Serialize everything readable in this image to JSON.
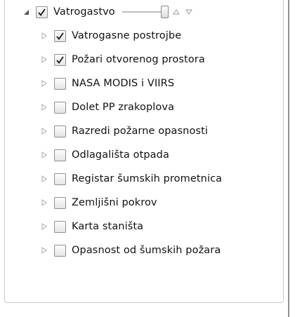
{
  "layer_tree": {
    "group": {
      "label": "Vatrogastvo",
      "checked": true,
      "expanded": true,
      "opacity_percent": 100
    },
    "children": [
      {
        "label": "Vatrogasne postrojbe",
        "checked": true
      },
      {
        "label": "Požari otvorenog prostora",
        "checked": true
      },
      {
        "label": "NASA MODIS i VIIRS",
        "checked": false
      },
      {
        "label": "Dolet PP zrakoplova",
        "checked": false
      },
      {
        "label": "Razredi požarne opasnosti",
        "checked": false
      },
      {
        "label": "Odlagališta otpada",
        "checked": false
      },
      {
        "label": "Registar šumskih prometnica",
        "checked": false
      },
      {
        "label": "Zemljišni pokrov",
        "checked": false
      },
      {
        "label": "Karta staništa",
        "checked": false
      },
      {
        "label": "Opasnost od šumskih požara",
        "checked": false
      }
    ]
  },
  "icons": {
    "expanded": "triangle-down-right-icon",
    "collapsed": "triangle-right-outline-icon",
    "checked": "checkmark-icon",
    "move_up": "triangle-up-outline-icon",
    "move_down": "triangle-down-outline-icon"
  },
  "colors": {
    "text": "#111111",
    "checkbox_border": "#8f8f8f",
    "expander": "#a8a8a8",
    "check_mark": "#1a1a1a"
  }
}
